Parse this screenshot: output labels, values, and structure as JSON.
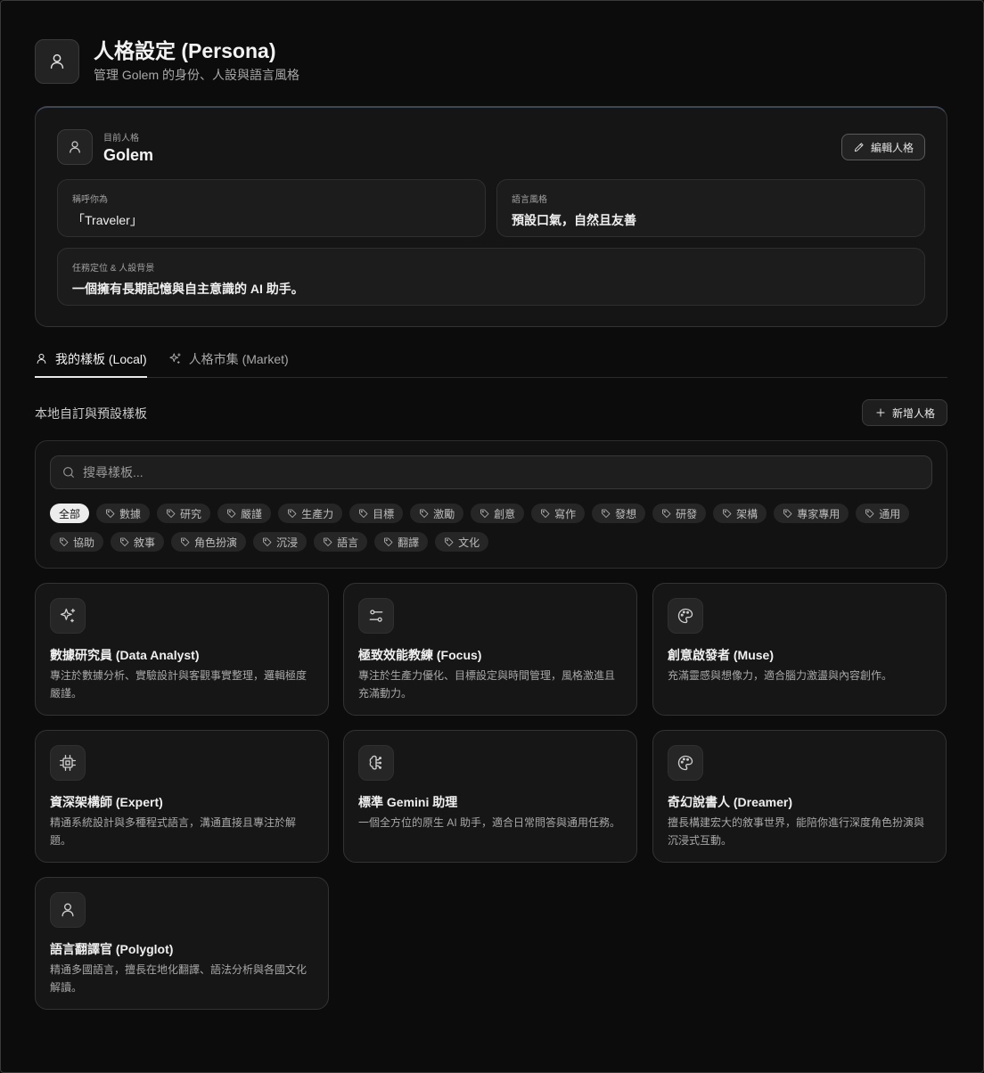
{
  "header": {
    "title": "人格設定 (Persona)",
    "subtitle": "管理 Golem 的身份、人設與語言風格"
  },
  "current": {
    "label": "目前人格",
    "name": "Golem",
    "edit_label": "編輯人格",
    "fields": {
      "call_label": "稱呼你為",
      "call_value": "「Traveler」",
      "style_label": "語言風格",
      "style_value": "預設口氣，自然且友善",
      "mission_label": "任務定位 & 人設背景",
      "mission_value": "一個擁有長期記憶與自主意識的 AI 助手。"
    }
  },
  "tabs": [
    {
      "label": "我的樣板 (Local)",
      "icon": "user-icon",
      "active": true
    },
    {
      "label": "人格市集 (Market)",
      "icon": "sparkles-icon",
      "active": false
    }
  ],
  "section": {
    "title": "本地自訂與預設樣板",
    "add_label": "新增人格"
  },
  "search": {
    "placeholder": "搜尋樣板...",
    "value": ""
  },
  "tags": [
    "全部",
    "數據",
    "研究",
    "嚴謹",
    "生產力",
    "目標",
    "激勵",
    "創意",
    "寫作",
    "發想",
    "研發",
    "架構",
    "專家專用",
    "通用",
    "協助",
    "敘事",
    "角色扮演",
    "沉浸",
    "語言",
    "翻譯",
    "文化"
  ],
  "personas": [
    {
      "name": "數據研究員 (Data Analyst)",
      "desc": "專注於數據分析、實驗設計與客觀事實整理，邏輯極度嚴謹。",
      "icon": "sparkles-icon"
    },
    {
      "name": "極致效能教練 (Focus)",
      "desc": "專注於生產力優化、目標設定與時間管理，風格激進且充滿動力。",
      "icon": "sliders-icon"
    },
    {
      "name": "創意啟發者 (Muse)",
      "desc": "充滿靈感與想像力，適合腦力激盪與內容創作。",
      "icon": "palette-icon"
    },
    {
      "name": "資深架構師 (Expert)",
      "desc": "精通系統設計與多種程式語言，溝通直接且專注於解題。",
      "icon": "cpu-icon"
    },
    {
      "name": "標準 Gemini 助理",
      "desc": "一個全方位的原生 AI 助手，適合日常問答與通用任務。",
      "icon": "brain-icon"
    },
    {
      "name": "奇幻說書人 (Dreamer)",
      "desc": "擅長構建宏大的敘事世界，能陪你進行深度角色扮演與沉浸式互動。",
      "icon": "palette-icon"
    },
    {
      "name": "語言翻譯官 (Polyglot)",
      "desc": "精通多國語言，擅長在地化翻譯、語法分析與各國文化解讀。",
      "icon": "user-icon"
    }
  ]
}
